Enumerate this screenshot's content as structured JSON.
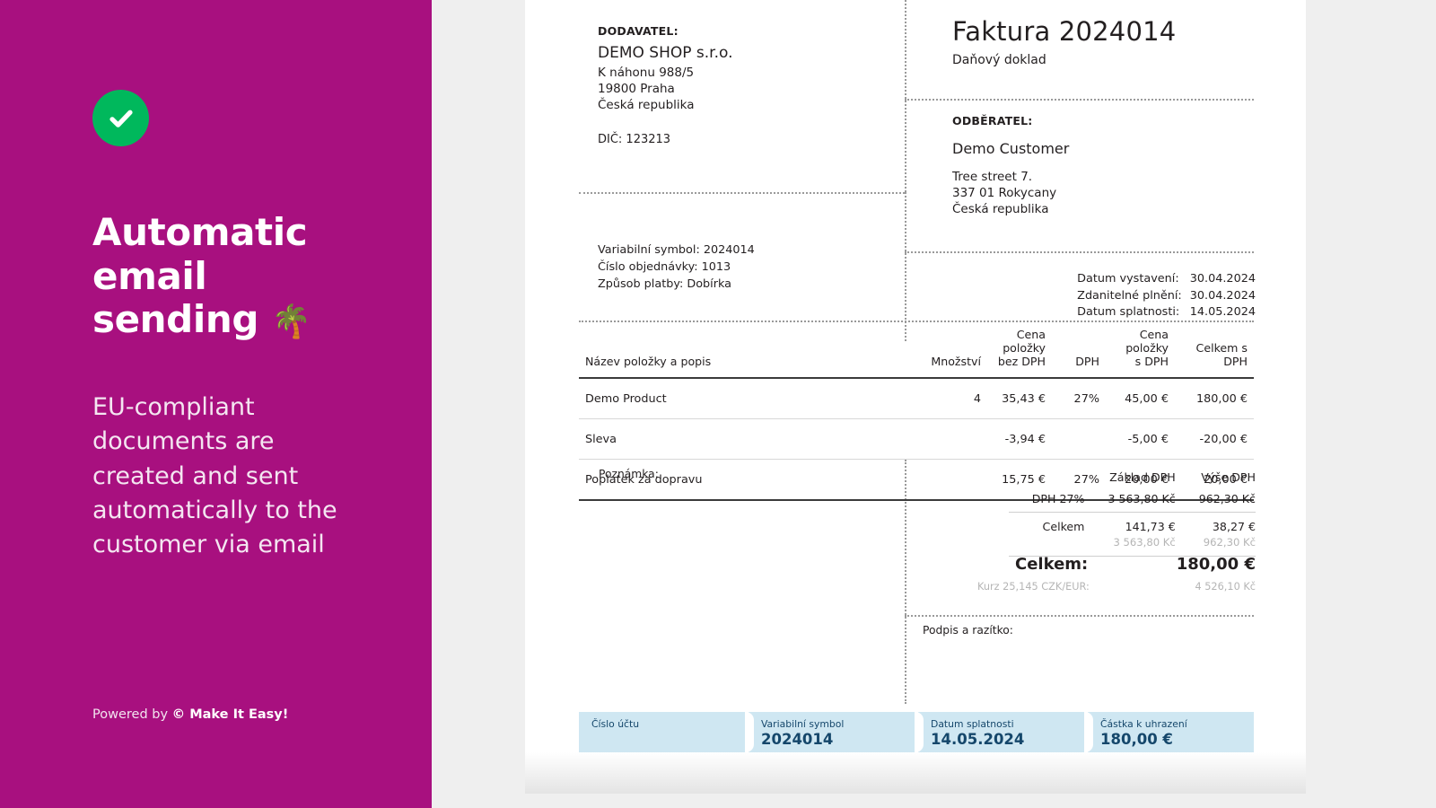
{
  "promo": {
    "icon": "check-circle-icon",
    "title_lines": [
      "Automatic",
      "email",
      "sending"
    ],
    "title_emoji": "🌴",
    "body": "EU-compliant documents are created and sent automatically to the customer via email",
    "footer_prefix": "Powered by ",
    "footer_symbol": "©",
    "footer_brand": "Make It Easy!",
    "bg_color": "#a8107f",
    "badge_color": "#00b85c"
  },
  "invoice": {
    "supplier": {
      "label": "DODAVATEL:",
      "name": "DEMO SHOP s.r.o.",
      "address_lines": [
        "K náhonu 988/5",
        "19800 Praha",
        "Česká republika"
      ],
      "tax_id": "DIČ: 123213"
    },
    "title": "Faktura 2024014",
    "subtitle": "Daňový doklad",
    "customer": {
      "label": "ODBĚRATEL:",
      "name": "Demo Customer",
      "address_lines": [
        "Tree street 7.",
        "337 01 Rokycany",
        "Česká republika"
      ]
    },
    "refs": [
      "Variabilní symbol: 2024014",
      "Číslo objednávky: 1013",
      "Způsob platby: Dobírka"
    ],
    "dates": [
      {
        "label": "Datum vystavení:",
        "value": "30.04.2024"
      },
      {
        "label": "Zdanitelné plnění:",
        "value": "30.04.2024"
      },
      {
        "label": "Datum splatnosti:",
        "value": "14.05.2024"
      }
    ],
    "table": {
      "headers": [
        "Název položky a popis",
        "Množství",
        "Cena položky bez DPH",
        "DPH",
        "Cena položky s DPH",
        "Celkem s DPH"
      ],
      "rows": [
        {
          "name": "Demo Product",
          "qty": "4",
          "unit_net": "35,43 €",
          "vat": "27%",
          "unit_gross": "45,00 €",
          "total": "180,00 €"
        },
        {
          "name": "Sleva",
          "qty": "",
          "unit_net": "-3,94 €",
          "vat": "",
          "unit_gross": "-5,00 €",
          "total": "-20,00 €"
        },
        {
          "name": "Poplatek za dopravu",
          "qty": "",
          "unit_net": "15,75 €",
          "vat": "27%",
          "unit_gross": "20,00 €",
          "total": "20,00 €"
        }
      ]
    },
    "note_label": "Poznámka:",
    "signature_label": "Podpis a razítko:",
    "summary": {
      "head_base": "Základ DPH",
      "head_amount": "Výše DPH",
      "vat_label": "DPH 27%",
      "vat_base": "3 563,80 Kč",
      "vat_amount": "962,30 Kč",
      "total_label": "Celkem",
      "total_base": "141,73 €",
      "total_amount": "38,27 €",
      "alt_base": "3 563,80 Kč",
      "alt_amount": "962,30 Kč"
    },
    "grand": {
      "label": "Celkem:",
      "value": "180,00 €",
      "rate_label": "Kurz 25,145 CZK/EUR:",
      "rate_value": "4 526,10 Kč"
    },
    "payment": [
      {
        "label": "Číslo účtu",
        "value": ""
      },
      {
        "label": "Variabilní symbol",
        "value": "2024014"
      },
      {
        "label": "Datum splatnosti",
        "value": "14.05.2024"
      },
      {
        "label": "Částka k uhrazení",
        "value": "180,00 €"
      }
    ]
  }
}
